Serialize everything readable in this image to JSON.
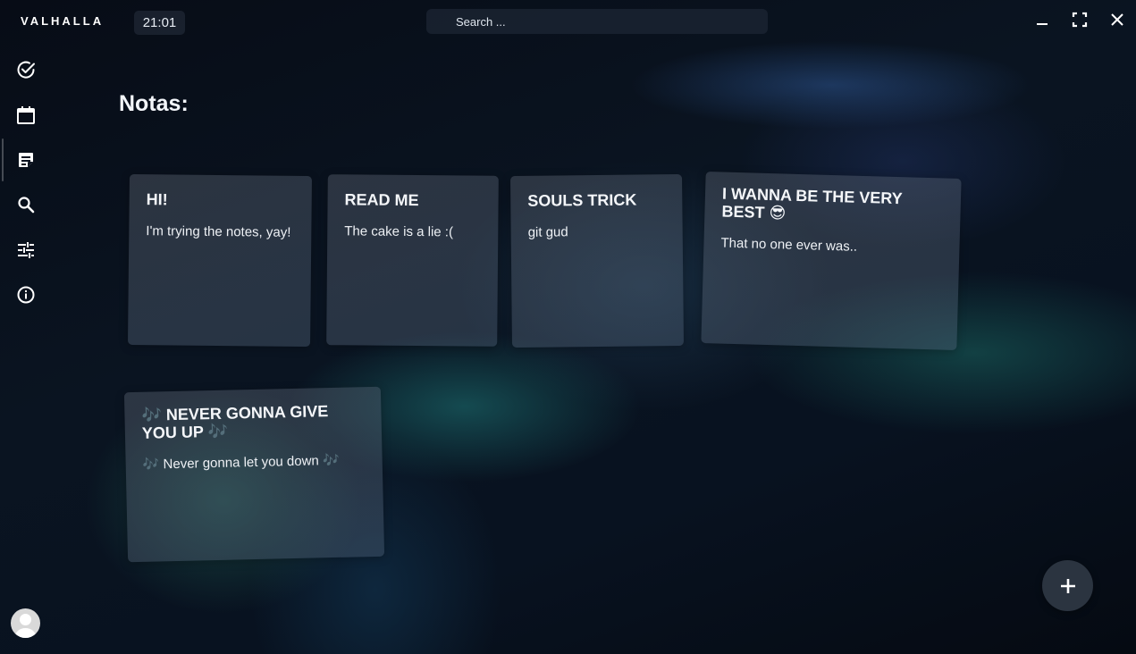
{
  "app": {
    "brand": "VALHALLA",
    "clock": "21:01"
  },
  "search": {
    "placeholder": "Search ..."
  },
  "window_controls": [
    "minimize-icon",
    "fullscreen-icon",
    "close-icon"
  ],
  "sidebar": {
    "items": [
      {
        "id": "tasks",
        "icon": "check-circle-icon"
      },
      {
        "id": "calendar",
        "icon": "calendar-icon"
      },
      {
        "id": "notes",
        "icon": "note-icon",
        "active": true
      },
      {
        "id": "search",
        "icon": "search-icon"
      },
      {
        "id": "settings",
        "icon": "sliders-icon"
      },
      {
        "id": "info",
        "icon": "info-icon"
      }
    ]
  },
  "page": {
    "title": "Notas:"
  },
  "notes": [
    {
      "title": "HI!",
      "body": "I'm trying the notes, yay!"
    },
    {
      "title": "READ ME",
      "body": "The cake is a lie :("
    },
    {
      "title": "SOULS TRICK",
      "body": "git gud"
    },
    {
      "title": "I WANNA BE THE VERY BEST 😎",
      "body": "That no one ever was.."
    },
    {
      "title": "🎶 NEVER GONNA GIVE YOU UP 🎶",
      "body": "🎶 Never gonna let you down 🎶"
    }
  ],
  "colors": {
    "accent": "#2b3440",
    "text": "#e9eef5",
    "background": "#070c16"
  },
  "fab": {
    "icon": "plus-icon"
  }
}
